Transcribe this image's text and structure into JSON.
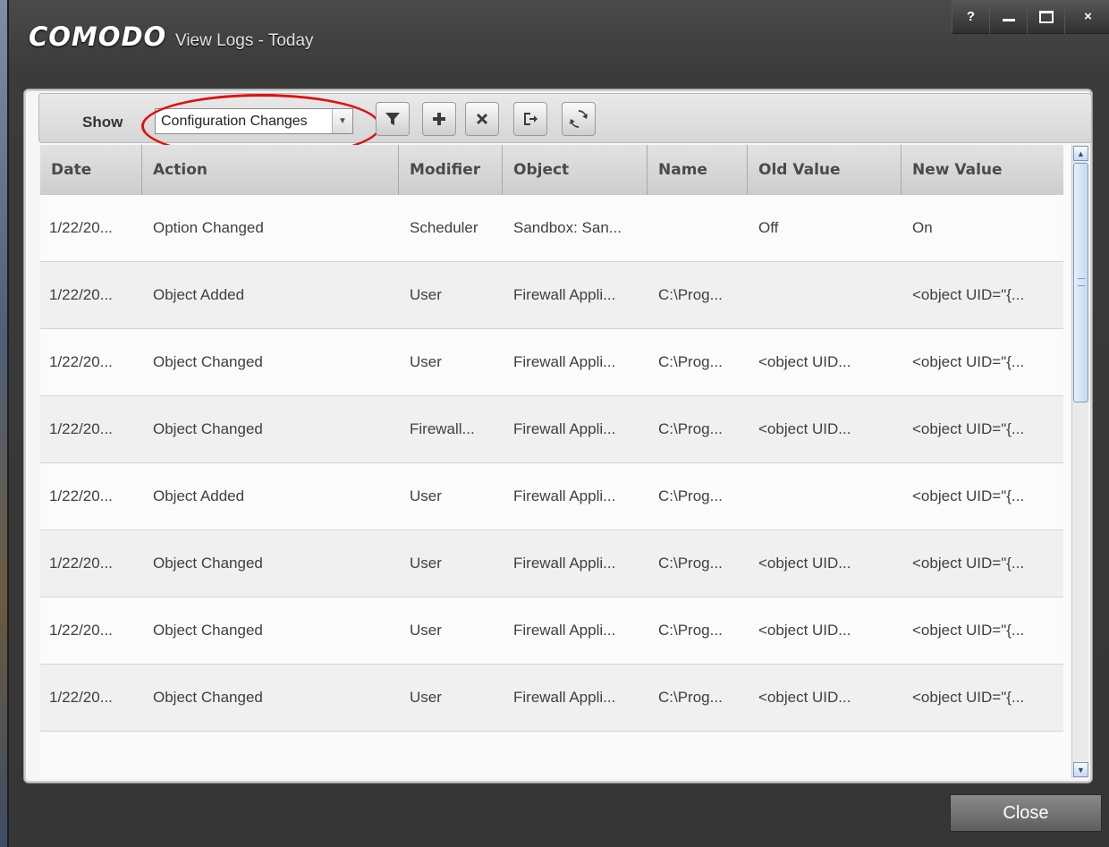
{
  "window": {
    "brand": "COMODO",
    "title": "View Logs - Today",
    "controls": {
      "help": "?",
      "close": "×"
    }
  },
  "toolbar": {
    "show_label": "Show",
    "filter_value": "Configuration Changes",
    "buttons": [
      "filter-icon",
      "add-icon",
      "delete-icon",
      "export-icon",
      "refresh-icon"
    ]
  },
  "table": {
    "columns": [
      "Date",
      "Action",
      "Modifier",
      "Object",
      "Name",
      "Old Value",
      "New Value"
    ],
    "rows": [
      [
        "1/22/20...",
        "Option Changed",
        "Scheduler",
        "Sandbox: San...",
        "",
        "Off",
        "On"
      ],
      [
        "1/22/20...",
        "Object Added",
        "User",
        "Firewall Appli...",
        "C:\\Prog...",
        "",
        "<object UID=\"{..."
      ],
      [
        "1/22/20...",
        "Object Changed",
        "User",
        "Firewall Appli...",
        "C:\\Prog...",
        "<object UID...",
        "<object UID=\"{..."
      ],
      [
        "1/22/20...",
        "Object Changed",
        "Firewall...",
        "Firewall Appli...",
        "C:\\Prog...",
        "<object UID...",
        "<object UID=\"{..."
      ],
      [
        "1/22/20...",
        "Object Added",
        "User",
        "Firewall Appli...",
        "C:\\Prog...",
        "",
        "<object UID=\"{..."
      ],
      [
        "1/22/20...",
        "Object Changed",
        "User",
        "Firewall Appli...",
        "C:\\Prog...",
        "<object UID...",
        "<object UID=\"{..."
      ],
      [
        "1/22/20...",
        "Object Changed",
        "User",
        "Firewall Appli...",
        "C:\\Prog...",
        "<object UID...",
        "<object UID=\"{..."
      ],
      [
        "1/22/20...",
        "Object Changed",
        "User",
        "Firewall Appli...",
        "C:\\Prog...",
        "<object UID...",
        "<object UID=\"{..."
      ]
    ]
  },
  "footer": {
    "close_label": "Close"
  },
  "colors": {
    "highlight": "#e01010",
    "scroll_accent": "#7a98c2"
  }
}
